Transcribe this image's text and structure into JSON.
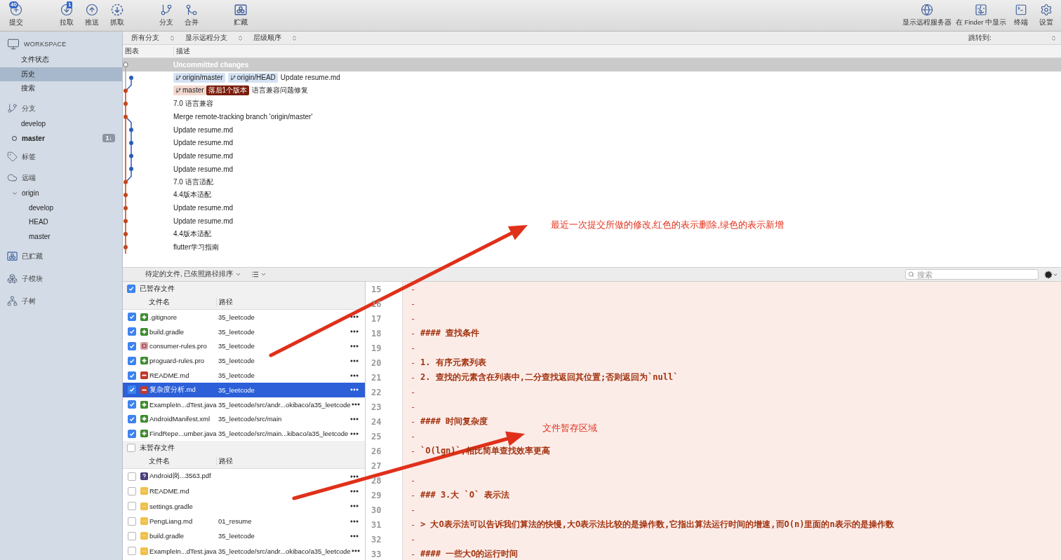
{
  "toolbar": {
    "left_groups": [
      {
        "buttons": [
          {
            "label": "提交",
            "badge": "40"
          }
        ]
      },
      {
        "buttons": [
          {
            "label": "拉取",
            "badge": "1"
          },
          {
            "label": "推送"
          },
          {
            "label": "抓取"
          }
        ]
      },
      {
        "buttons": [
          {
            "label": "分支"
          },
          {
            "label": "合并"
          }
        ]
      },
      {
        "buttons": [
          {
            "label": "贮藏"
          }
        ]
      }
    ],
    "right": [
      {
        "label": "显示远程服务器"
      },
      {
        "label": "在 Finder 中显示"
      },
      {
        "label": "终端"
      },
      {
        "label": "设置"
      }
    ]
  },
  "sidebar": {
    "sections": [
      {
        "kind": "workspace",
        "title": "WORKSPACE",
        "items": [
          {
            "label": "文件状态",
            "selected": false
          },
          {
            "label": "历史",
            "selected": true
          },
          {
            "label": "搜索",
            "selected": false
          }
        ]
      },
      {
        "kind": "branches",
        "title": "分支",
        "items": [
          {
            "label": "develop",
            "selected": false,
            "current": false
          },
          {
            "label": "master",
            "selected": false,
            "current": true,
            "badge": "1↓"
          }
        ]
      },
      {
        "kind": "tags",
        "title": "标签"
      },
      {
        "kind": "remotes",
        "title": "远端",
        "items": [
          {
            "label": "origin",
            "selected": false,
            "expanded": true,
            "children": [
              {
                "label": "develop",
                "selected": false
              },
              {
                "label": "HEAD",
                "selected": false
              },
              {
                "label": "master",
                "selected": false
              }
            ]
          }
        ]
      },
      {
        "kind": "stashes",
        "title": "已贮藏"
      },
      {
        "kind": "submodules",
        "title": "子模块"
      },
      {
        "kind": "subtrees",
        "title": "子树"
      }
    ]
  },
  "filters": [
    {
      "label": "所有分支"
    },
    {
      "label": "显示远程分支"
    },
    {
      "label": "层级顺序"
    }
  ],
  "jump_to": {
    "label": "跳转到:"
  },
  "history": {
    "columns": [
      "图表",
      "描述"
    ],
    "commits": [
      {
        "kind": "uncommitted",
        "color": "#9a9a9a",
        "selected": true,
        "description": "Uncommitted changes"
      },
      {
        "kind": "side",
        "color": "#2c5bb8",
        "selected": false,
        "refs": [
          {
            "label": "origin/master",
            "kind": "remote"
          },
          {
            "label": "origin/HEAD",
            "kind": "remote"
          }
        ],
        "description": "Update resume.md"
      },
      {
        "kind": "main",
        "color": "#c1461d",
        "selected": false,
        "refs": [
          {
            "label": "master",
            "kind": "local"
          },
          {
            "label": "落后1个版本",
            "kind": "behind"
          }
        ],
        "description": "语言兼容问题修复"
      },
      {
        "kind": "main",
        "color": "#c1461d",
        "selected": false,
        "description": "7.0 语言兼容"
      },
      {
        "kind": "main",
        "color": "#c1461d",
        "selected": false,
        "description": "Merge remote-tracking branch 'origin/master'"
      },
      {
        "kind": "side",
        "color": "#2c5bb8",
        "selected": false,
        "description": "Update resume.md"
      },
      {
        "kind": "side",
        "color": "#2c5bb8",
        "selected": false,
        "description": "Update resume.md"
      },
      {
        "kind": "side",
        "color": "#2c5bb8",
        "selected": false,
        "description": "Update resume.md"
      },
      {
        "kind": "side",
        "color": "#2c5bb8",
        "selected": false,
        "description": "Update resume.md"
      },
      {
        "kind": "main",
        "color": "#c1461d",
        "selected": false,
        "description": "7.0 语言适配"
      },
      {
        "kind": "main",
        "color": "#c1461d",
        "selected": false,
        "description": "4.4版本适配"
      },
      {
        "kind": "main",
        "color": "#c1461d",
        "selected": false,
        "description": "Update resume.md"
      },
      {
        "kind": "main",
        "color": "#c1461d",
        "selected": false,
        "description": "Update resume.md"
      },
      {
        "kind": "main",
        "color": "#c1461d",
        "selected": false,
        "description": "4.4版本适配"
      },
      {
        "kind": "main",
        "color": "#c1461d",
        "selected": false,
        "description": "flutter学习指南"
      }
    ]
  },
  "files_toolbar": {
    "sort_label": "待定的文件, 已依照路径排序",
    "search": {
      "placeholder": "搜索"
    }
  },
  "staged": {
    "title": "已暂存文件",
    "checked": true,
    "columns": [
      "文件名",
      "路径"
    ],
    "files": [
      {
        "name": ".gitignore",
        "path": "35_leetcode",
        "kind": "added",
        "checked": true,
        "selected": false
      },
      {
        "name": "build.gradle",
        "path": "35_leetcode",
        "kind": "added",
        "checked": true,
        "selected": false
      },
      {
        "name": "consumer-rules.pro",
        "path": "35_leetcode",
        "kind": "renamed",
        "checked": true,
        "selected": false
      },
      {
        "name": "proguard-rules.pro",
        "path": "35_leetcode",
        "kind": "added",
        "checked": true,
        "selected": false
      },
      {
        "name": "README.md",
        "path": "35_leetcode",
        "kind": "removed",
        "checked": true,
        "selected": false
      },
      {
        "name": "复杂度分析.md",
        "path": "35_leetcode",
        "kind": "removed",
        "checked": true,
        "selected": true
      },
      {
        "name": "ExampleIn...dTest.java",
        "path": "35_leetcode/src/andr...okibaco/a35_leetcode",
        "kind": "added",
        "checked": true,
        "selected": false
      },
      {
        "name": "AndroidManifest.xml",
        "path": "35_leetcode/src/main",
        "kind": "added",
        "checked": true,
        "selected": false
      },
      {
        "name": "FindRepe...umber.java",
        "path": "35_leetcode/src/main...kibaco/a35_leetcode",
        "kind": "added",
        "checked": true,
        "selected": false
      }
    ]
  },
  "unstaged": {
    "title": "未暂存文件",
    "checked": false,
    "columns": [
      "文件名",
      "路径"
    ],
    "files": [
      {
        "name": "Android岗...3563.pdf",
        "kind": "unknown",
        "checked": false,
        "selected": false
      },
      {
        "name": "README.md",
        "kind": "modified",
        "checked": false,
        "selected": false
      },
      {
        "name": "settings.gradle",
        "kind": "modified",
        "checked": false,
        "selected": false
      },
      {
        "name": "PengLiang.md",
        "path": "01_resume",
        "kind": "modified",
        "checked": false,
        "selected": false
      },
      {
        "name": "build.gradle",
        "path": "35_leetcode",
        "kind": "modified",
        "checked": false,
        "selected": false
      },
      {
        "name": "ExampleIn...dTest.java",
        "path": "35_leetcode/src/andr...okibaco/a35_leetcode",
        "kind": "modified",
        "checked": false,
        "selected": false
      }
    ]
  },
  "diff": {
    "lines": [
      {
        "number": "15",
        "marker": "-"
      },
      {
        "number": "16",
        "marker": "-"
      },
      {
        "number": "17",
        "marker": "-"
      },
      {
        "number": "18",
        "marker": "-",
        "text": "#### 查找条件"
      },
      {
        "number": "19",
        "marker": "-"
      },
      {
        "number": "20",
        "marker": "-",
        "text": "1. 有序元素列表"
      },
      {
        "number": "21",
        "marker": "-",
        "text": "2. 查找的元素含在列表中,二分查找返回其位置;否则返回为`null`"
      },
      {
        "number": "22",
        "marker": "-"
      },
      {
        "number": "23",
        "marker": "-"
      },
      {
        "number": "24",
        "marker": "-",
        "text": "#### 时间复杂度"
      },
      {
        "number": "25",
        "marker": "-"
      },
      {
        "number": "26",
        "marker": "-",
        "text": "`O(lgn)`,相比简单查找效率更高"
      },
      {
        "number": "27"
      },
      {
        "number": "28",
        "marker": "-"
      },
      {
        "number": "29",
        "marker": "-",
        "text": "### 3.大 `O` 表示法"
      },
      {
        "number": "30",
        "marker": "-"
      },
      {
        "number": "31",
        "marker": "-",
        "text": "> 大O表示法可以告诉我们算法的快慢,大O表示法比较的是操作数,它指出算法运行时间的增速,而O(n)里面的n表示的是操作数"
      },
      {
        "number": "32",
        "marker": "-"
      },
      {
        "number": "33",
        "marker": "-",
        "text": "#### 一些大O的运行时间"
      }
    ]
  },
  "annotations": [
    {
      "text": "最近一次提交所做的修改,红色的表示删除,绿色的表示新增"
    },
    {
      "text": "文件暂存区域"
    }
  ]
}
